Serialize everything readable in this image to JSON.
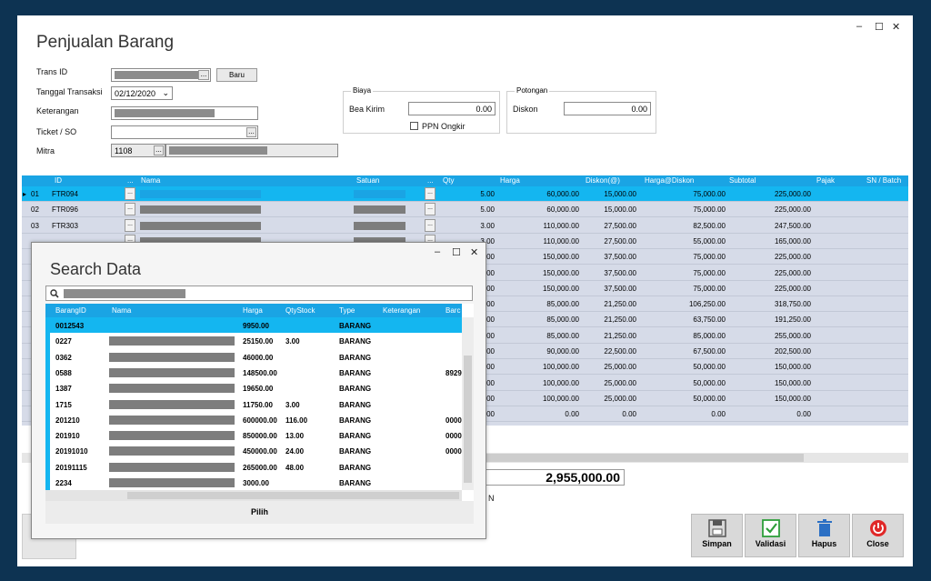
{
  "window": {
    "title": "Penjualan Barang",
    "min": "–",
    "max": "☐",
    "close": "✕"
  },
  "form": {
    "trans_id_label": "Trans ID",
    "trans_id_btn": "...",
    "baru": "Baru",
    "tanggal_label": "Tanggal Transaksi",
    "tanggal_value": "02/12/2020",
    "keterangan_label": "Keterangan",
    "ticket_label": "Ticket / SO",
    "ticket_btn": "...",
    "mitra_label": "Mitra",
    "mitra_value": "1108",
    "mitra_btn": "..."
  },
  "biaya": {
    "title": "Biaya",
    "bea_kirim_label": "Bea Kirim",
    "bea_kirim_value": "0.00",
    "ppn_label": "PPN Ongkir"
  },
  "potongan": {
    "title": "Potongan",
    "diskon_label": "Diskon",
    "diskon_value": "0.00"
  },
  "grid": {
    "headers": [
      "ID",
      "...",
      "Nama",
      "Satuan",
      "...",
      "Qty",
      "Harga",
      "Diskon(@)",
      "Harga@Diskon",
      "Subtotal",
      "Pajak",
      "SN / Batch"
    ],
    "rows": [
      {
        "no": "01",
        "id": "FTR094",
        "qty": "5.00",
        "harga": "60,000.00",
        "diskon": "15,000.00",
        "hd": "75,000.00",
        "sub": "225,000.00"
      },
      {
        "no": "02",
        "id": "FTR096",
        "qty": "5.00",
        "harga": "60,000.00",
        "diskon": "15,000.00",
        "hd": "75,000.00",
        "sub": "225,000.00"
      },
      {
        "no": "03",
        "id": "FTR303",
        "qty": "3.00",
        "harga": "110,000.00",
        "diskon": "27,500.00",
        "hd": "82,500.00",
        "sub": "247,500.00"
      },
      {
        "no": "",
        "id": "",
        "qty": "3.00",
        "harga": "110,000.00",
        "diskon": "27,500.00",
        "hd": "55,000.00",
        "sub": "165,000.00"
      },
      {
        "no": "",
        "id": "",
        "qty": "00",
        "harga": "150,000.00",
        "diskon": "37,500.00",
        "hd": "75,000.00",
        "sub": "225,000.00"
      },
      {
        "no": "",
        "id": "",
        "qty": "00",
        "harga": "150,000.00",
        "diskon": "37,500.00",
        "hd": "75,000.00",
        "sub": "225,000.00"
      },
      {
        "no": "",
        "id": "",
        "qty": "00",
        "harga": "150,000.00",
        "diskon": "37,500.00",
        "hd": "75,000.00",
        "sub": "225,000.00"
      },
      {
        "no": "",
        "id": "",
        "qty": "00",
        "harga": "85,000.00",
        "diskon": "21,250.00",
        "hd": "106,250.00",
        "sub": "318,750.00"
      },
      {
        "no": "",
        "id": "",
        "qty": "00",
        "harga": "85,000.00",
        "diskon": "21,250.00",
        "hd": "63,750.00",
        "sub": "191,250.00"
      },
      {
        "no": "",
        "id": "",
        "qty": "00",
        "harga": "85,000.00",
        "diskon": "21,250.00",
        "hd": "85,000.00",
        "sub": "255,000.00"
      },
      {
        "no": "",
        "id": "",
        "qty": "00",
        "harga": "90,000.00",
        "diskon": "22,500.00",
        "hd": "67,500.00",
        "sub": "202,500.00"
      },
      {
        "no": "",
        "id": "",
        "qty": "00",
        "harga": "100,000.00",
        "diskon": "25,000.00",
        "hd": "50,000.00",
        "sub": "150,000.00"
      },
      {
        "no": "",
        "id": "",
        "qty": "00",
        "harga": "100,000.00",
        "diskon": "25,000.00",
        "hd": "50,000.00",
        "sub": "150,000.00"
      },
      {
        "no": "",
        "id": "",
        "qty": "00",
        "harga": "100,000.00",
        "diskon": "25,000.00",
        "hd": "50,000.00",
        "sub": "150,000.00"
      },
      {
        "no": "",
        "id": "",
        "qty": "00",
        "harga": "0.00",
        "diskon": "0.00",
        "hd": "0.00",
        "sub": "0.00"
      }
    ]
  },
  "total": "2,955,000.00",
  "total_suffix": "N",
  "actions": {
    "simpan": "Simpan",
    "validasi": "Validasi",
    "hapus": "Hapus",
    "close": "Close"
  },
  "search_modal": {
    "title": "Search Data",
    "min": "–",
    "max": "☐",
    "close": "✕",
    "headers": [
      "BarangID",
      "Nama",
      "Harga",
      "QtyStock",
      "Type",
      "Keterangan",
      "Barc"
    ],
    "rows": [
      {
        "id": "0012543",
        "harga": "9950.00",
        "qty": "",
        "type": "BARANG",
        "barc": ""
      },
      {
        "id": "0227",
        "harga": "25150.00",
        "qty": "3.00",
        "type": "BARANG",
        "barc": ""
      },
      {
        "id": "0362",
        "harga": "46000.00",
        "qty": "",
        "type": "BARANG",
        "barc": ""
      },
      {
        "id": "0588",
        "harga": "148500.00",
        "qty": "",
        "type": "BARANG",
        "barc": "8929"
      },
      {
        "id": "1387",
        "harga": "19650.00",
        "qty": "",
        "type": "BARANG",
        "barc": ""
      },
      {
        "id": "1715",
        "harga": "11750.00",
        "qty": "3.00",
        "type": "BARANG",
        "barc": ""
      },
      {
        "id": "201210",
        "harga": "600000.00",
        "qty": "116.00",
        "type": "BARANG",
        "barc": "0000"
      },
      {
        "id": "201910",
        "harga": "850000.00",
        "qty": "13.00",
        "type": "BARANG",
        "barc": "0000"
      },
      {
        "id": "20191010",
        "harga": "450000.00",
        "qty": "24.00",
        "type": "BARANG",
        "barc": "0000"
      },
      {
        "id": "20191115",
        "harga": "265000.00",
        "qty": "48.00",
        "type": "BARANG",
        "barc": ""
      },
      {
        "id": "2234",
        "harga": "3000.00",
        "qty": "",
        "type": "BARANG",
        "barc": ""
      }
    ],
    "pilih": "Pilih"
  },
  "colors": {
    "accent": "#1aa4e4",
    "selected": "#14b6f0",
    "frame": "#0d3352"
  }
}
